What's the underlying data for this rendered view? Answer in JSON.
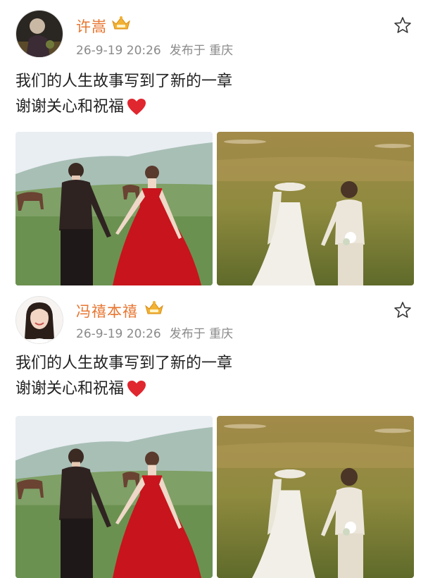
{
  "posts": [
    {
      "username": "许嵩",
      "time": "26-9-19 20:26",
      "source": "发布于 重庆",
      "text_line1": "我们的人生故事写到了新的一章",
      "text_line2": "谢谢关心和祝福",
      "icons": [
        "vip-crown-icon",
        "star-icon",
        "heart-emoji-icon"
      ]
    },
    {
      "username": "冯禧本禧",
      "time": "26-9-19 20:26",
      "source": "发布于 重庆",
      "text_line1": "我们的人生故事写到了新的一章",
      "text_line2": "谢谢关心和祝福",
      "icons": [
        "vip-crown-icon",
        "star-icon",
        "heart-emoji-icon"
      ]
    }
  ],
  "colors": {
    "username": "#e8752f",
    "meta": "#8a8a8a",
    "heart": "#e0262e",
    "dress": "#c8141c"
  }
}
